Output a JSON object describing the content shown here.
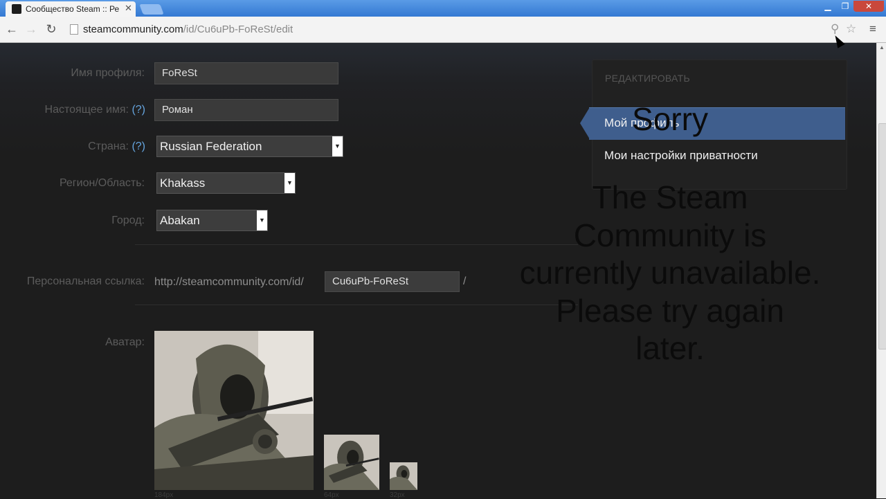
{
  "browser": {
    "tab_title": "Сообщество Steam :: Ре",
    "tab_close": "✕",
    "url_domain": "steamcommunity.com",
    "url_path": "/id/Cu6uPb-FoReSt/edit",
    "icons": [
      "back-icon",
      "forward-icon",
      "reload-icon",
      "page-icon",
      "zoom-icon",
      "star-icon",
      "menu-icon"
    ],
    "window_controls": [
      "minimize",
      "restore",
      "close"
    ]
  },
  "form": {
    "profile_name": {
      "label": "Имя профиля:",
      "value": "FoReSt"
    },
    "real_name": {
      "label": "Настоящее имя:",
      "help": "(?)",
      "value": "Роман"
    },
    "country": {
      "label": "Страна:",
      "help": "(?)",
      "value": "Russian Federation"
    },
    "region": {
      "label": "Регион/Область:",
      "value": "Khakass"
    },
    "city": {
      "label": "Город:",
      "value": "Abakan"
    },
    "custom_url": {
      "label": "Персональная ссылка:",
      "prefix": "http://steamcommunity.com/id/",
      "value": "Cu6uPb-FoReSt",
      "suffix": "/"
    },
    "avatar": {
      "label": "Аватар:",
      "sizes": [
        "184px",
        "64px",
        "32px"
      ]
    }
  },
  "panel": {
    "title": "РЕДАКТИРОВАТЬ",
    "items": [
      {
        "label": "Мой профиль",
        "active": true
      },
      {
        "label": "Мои настройки приватности",
        "active": false
      }
    ]
  },
  "overlay": {
    "title": "Sorry",
    "message": "The Steam Community is currently unavailable. Please try again later."
  },
  "colors": {
    "accent": "#3f5e8d",
    "help_link": "#66a6e0",
    "page_bg": "#1c1c1c"
  }
}
